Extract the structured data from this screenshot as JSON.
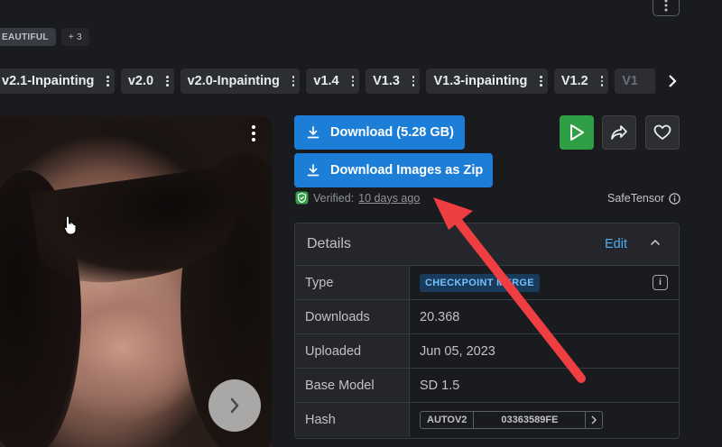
{
  "tags": {
    "items": [
      "EAUTIFUL"
    ],
    "more": "+ 3"
  },
  "versions": {
    "items": [
      "v2.1-Inpainting",
      "v2.0",
      "v2.0-Inpainting",
      "v1.4",
      "V1.3",
      "V1.3-inpainting",
      "V1.2",
      "V1"
    ]
  },
  "actions": {
    "download_label": "Download (5.28 GB)",
    "download_zip_label": "Download Images as Zip"
  },
  "verification": {
    "label": "Verified:",
    "time_ago": "10 days ago",
    "format": "SafeTensor"
  },
  "details": {
    "title": "Details",
    "edit_label": "Edit",
    "rows": {
      "type": {
        "label": "Type",
        "value": "CHECKPOINT MERGE"
      },
      "downloads": {
        "label": "Downloads",
        "value": "20.368"
      },
      "uploaded": {
        "label": "Uploaded",
        "value": "Jun 05, 2023"
      },
      "base_model": {
        "label": "Base Model",
        "value": "SD 1.5"
      },
      "hash": {
        "label": "Hash",
        "algo": "AUTOV2",
        "value": "03363589FE"
      }
    }
  },
  "colors": {
    "primary": "#1c7ed6",
    "play": "#2f9e44",
    "annotation_arrow": "#ef3e42"
  },
  "icons": {
    "download": "download-icon",
    "play": "play-icon",
    "share": "share-icon",
    "heart": "heart-icon",
    "verified": "shield-check-icon",
    "info": "info-circle-icon"
  }
}
